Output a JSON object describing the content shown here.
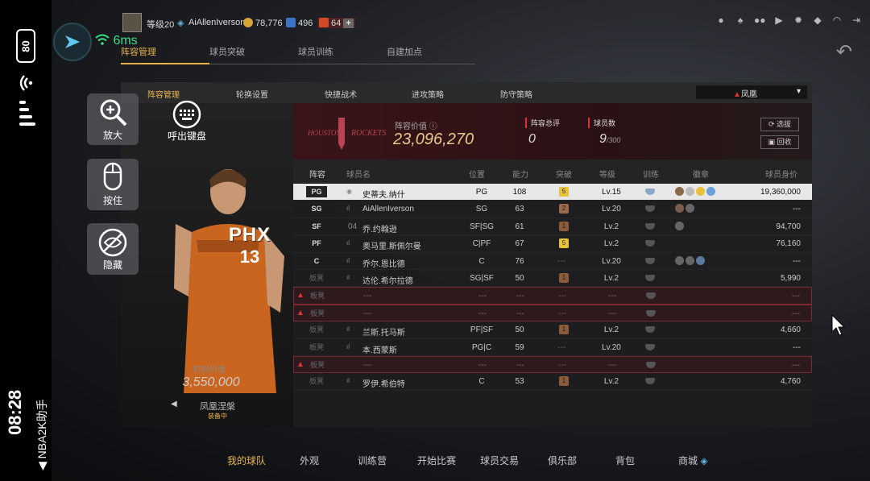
{
  "status_bar": {
    "battery": "80",
    "time": "08:28",
    "app_name": "NBA2K助手"
  },
  "ping": {
    "value": "6ms"
  },
  "header": {
    "level": "等级20",
    "username": "AiAllenIverson",
    "coins": "78,776",
    "points": "496",
    "tickets": "64"
  },
  "top_tabs": [
    "阵容管理",
    "球员突破",
    "球员训练",
    "自建加点"
  ],
  "sub_tabs": [
    "阵容管理",
    "轮换设置",
    "快捷战术",
    "进攻策略",
    "防守策略"
  ],
  "team_dropdown": "凤凰",
  "team": {
    "logo_text": "ROCKETS",
    "value_label": "阵容价值",
    "value": "23,096,270",
    "rating_label": "阵容总评",
    "rating": "0",
    "players_label": "球员数",
    "players": "9",
    "players_max": "/300",
    "btn_select": "选拔",
    "btn_recycle": "回收"
  },
  "player_card": {
    "jersey": "PHX",
    "number": "13",
    "value_label": "时刻价值",
    "value": "3,550,000",
    "name": "凤凰涅槃",
    "status": "装备中"
  },
  "tools": {
    "zoom": "放大",
    "keyboard": "呼出键盘",
    "hold": "按住",
    "hide": "隐藏"
  },
  "table": {
    "headers": [
      "阵容",
      "球员名",
      "位置",
      "能力",
      "突破",
      "等级",
      "训练",
      "徽章",
      "球员身价"
    ],
    "rows": [
      {
        "slot": "PG",
        "name": "史蒂夫.纳什",
        "pos": "PG",
        "ability": "108",
        "break": "5",
        "level": "Lv.15",
        "value": "19,360,000",
        "type": "sel"
      },
      {
        "slot": "SG",
        "name": "AiAllenIverson",
        "pos": "SG",
        "ability": "63",
        "break": "2",
        "level": "Lv.20",
        "value": "---",
        "type": "starter"
      },
      {
        "slot": "SF",
        "name": "乔.约翰逊",
        "prefix": "04",
        "pos": "SF|SG",
        "ability": "61",
        "break": "1",
        "level": "Lv.2",
        "value": "94,700",
        "type": "starter"
      },
      {
        "slot": "PF",
        "name": "奥马里.斯佩尔曼",
        "pos": "C|PF",
        "ability": "67",
        "break": "5",
        "level": "Lv.2",
        "value": "76,160",
        "type": "starter"
      },
      {
        "slot": "C",
        "name": "乔尔.恩比德",
        "pos": "C",
        "ability": "76",
        "break": "---",
        "level": "Lv.20",
        "value": "---",
        "type": "starter"
      },
      {
        "slot": "板凳",
        "name": "达伦.希尔拉德",
        "pos": "SG|SF",
        "ability": "50",
        "break": "1",
        "level": "Lv.2",
        "value": "5,990",
        "type": "bench"
      },
      {
        "slot": "板凳",
        "name": "---",
        "pos": "---",
        "ability": "---",
        "break": "---",
        "level": "---",
        "value": "---",
        "type": "red"
      },
      {
        "slot": "板凳",
        "name": "---",
        "pos": "---",
        "ability": "---",
        "break": "---",
        "level": "---",
        "value": "---",
        "type": "red"
      },
      {
        "slot": "板凳",
        "name": "兰斯.托马斯",
        "pos": "PF|SF",
        "ability": "50",
        "break": "1",
        "level": "Lv.2",
        "value": "4,660",
        "type": "bench"
      },
      {
        "slot": "板凳",
        "name": "本.西蒙斯",
        "pos": "PG|C",
        "ability": "59",
        "break": "---",
        "level": "Lv.20",
        "value": "---",
        "type": "bench"
      },
      {
        "slot": "板凳",
        "name": "---",
        "pos": "---",
        "ability": "---",
        "break": "---",
        "level": "---",
        "value": "---",
        "type": "red"
      },
      {
        "slot": "板凳",
        "name": "罗伊.希伯特",
        "pos": "C",
        "ability": "53",
        "break": "1",
        "level": "Lv.2",
        "value": "4,760",
        "type": "bench"
      }
    ]
  },
  "bottom_nav": [
    "我的球队",
    "外观",
    "训练营",
    "开始比赛",
    "球员交易",
    "俱乐部",
    "背包",
    "商城"
  ],
  "colors": {
    "accent": "#e8b44a",
    "warning": "#d33333",
    "ping": "#36e084"
  }
}
